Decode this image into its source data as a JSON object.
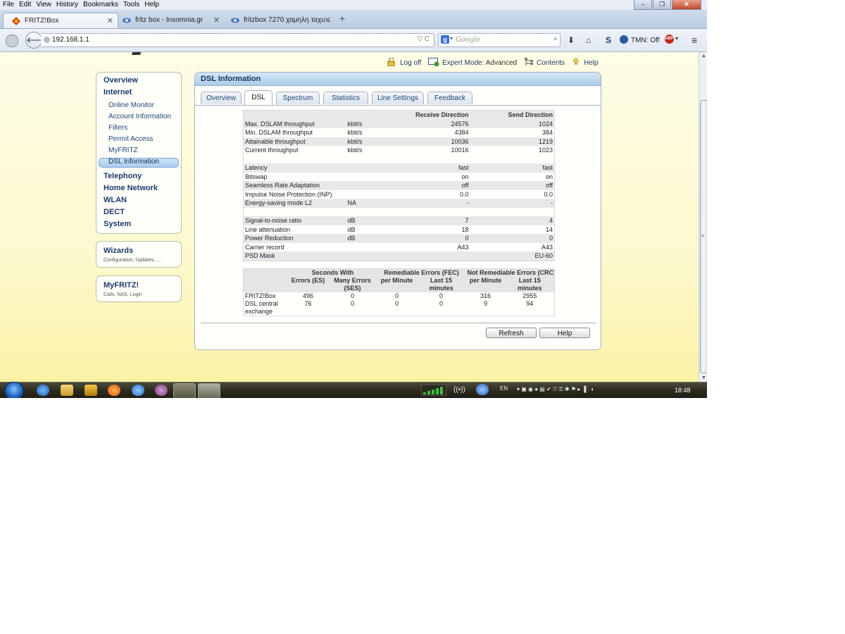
{
  "browser": {
    "menu": [
      "File",
      "Edit",
      "View",
      "History",
      "Bookmarks",
      "Tools",
      "Help"
    ],
    "tabs": [
      {
        "title": "FRITZ!Box",
        "active": true
      },
      {
        "title": "fritz box - Insomnia.gr",
        "active": false
      },
      {
        "title": "fritzbox 7270 χαμηλη ταχυ...",
        "active": false
      }
    ],
    "url": "192.168.1.1",
    "search_placeholder": "Google",
    "addon_label": "TMN: Off"
  },
  "topnav": {
    "logoff": "Log off",
    "expert_label": "Expert Mode:",
    "expert_value": "Advanced",
    "contents": "Contents",
    "help": "Help"
  },
  "sidebar": {
    "main": [
      {
        "label": "Overview",
        "level": 0
      },
      {
        "label": "Internet",
        "level": 0
      },
      {
        "label": "Online Monitor",
        "level": 1
      },
      {
        "label": "Account Information",
        "level": 1
      },
      {
        "label": "Filters",
        "level": 1
      },
      {
        "label": "Permit Access",
        "level": 1
      },
      {
        "label": "MyFRITZ",
        "level": 1
      },
      {
        "label": "DSL Information",
        "level": 1,
        "selected": true
      },
      {
        "label": "Telephony",
        "level": 0
      },
      {
        "label": "Home Network",
        "level": 0
      },
      {
        "label": "WLAN",
        "level": 0
      },
      {
        "label": "DECT",
        "level": 0
      },
      {
        "label": "System",
        "level": 0
      }
    ],
    "wizards": {
      "title": "Wizards",
      "subtitle": "Configuration, Updates, ..."
    },
    "myfritz": {
      "title": "MyFRITZ!",
      "subtitle": "Calls, NAS, Login"
    }
  },
  "panel": {
    "title": "DSL Information",
    "tabs": [
      "Overview",
      "DSL",
      "Spectrum",
      "Statistics",
      "Line Settings",
      "Feedback"
    ],
    "active_tab": "DSL",
    "dsl_table": {
      "headers": [
        "",
        "",
        "Receive Direction",
        "Send Direction"
      ],
      "groups": [
        [
          [
            "Max. DSLAM throughput",
            "kbit/s",
            "24576",
            "1024"
          ],
          [
            "Min. DSLAM throughput",
            "kbit/s",
            "4384",
            "384"
          ],
          [
            "Attainable throughput",
            "kbit/s",
            "10036",
            "1219"
          ],
          [
            "Current throughput",
            "kbit/s",
            "10016",
            "1023"
          ]
        ],
        [
          [
            "Latency",
            "",
            "fast",
            "fast"
          ],
          [
            "Bitswap",
            "",
            "on",
            "on"
          ],
          [
            "Seamless Rate Adaptation",
            "",
            "off",
            "off"
          ],
          [
            "Impulse Noise Protection (INP)",
            "",
            "0.0",
            "0.0"
          ],
          [
            "Energy-saving mode L2",
            "NA",
            "-",
            "-"
          ]
        ],
        [
          [
            "Signal-to-noise ratio",
            "dB",
            "7",
            "4"
          ],
          [
            "Line attenuation",
            "dB",
            "18",
            "14"
          ],
          [
            "Power Reduction",
            "dB",
            "0",
            "0"
          ],
          [
            "Carrier record",
            "",
            "A43",
            "A43"
          ],
          [
            "PSD Mask",
            "",
            "",
            "EU-60"
          ]
        ]
      ]
    },
    "error_table": {
      "group_headers": [
        "Seconds With",
        "Remediable Errors (FEC)",
        "Not Remediable Errors (CRC)"
      ],
      "sub_headers": [
        "Errors (ES)",
        "Many Errors (SES)",
        "per Minute",
        "Last 15 minutes",
        "per Minute",
        "Last 15 minutes"
      ],
      "rows": [
        [
          "FRITZ!Box",
          "496",
          "0",
          "0",
          "0",
          "316",
          "2955"
        ],
        [
          "DSL central exchange",
          "76",
          "0",
          "0",
          "0",
          "9",
          "94"
        ]
      ]
    },
    "buttons": {
      "refresh": "Refresh",
      "help": "Help"
    }
  },
  "taskbar": {
    "language": "EN",
    "clock": "18:48"
  }
}
